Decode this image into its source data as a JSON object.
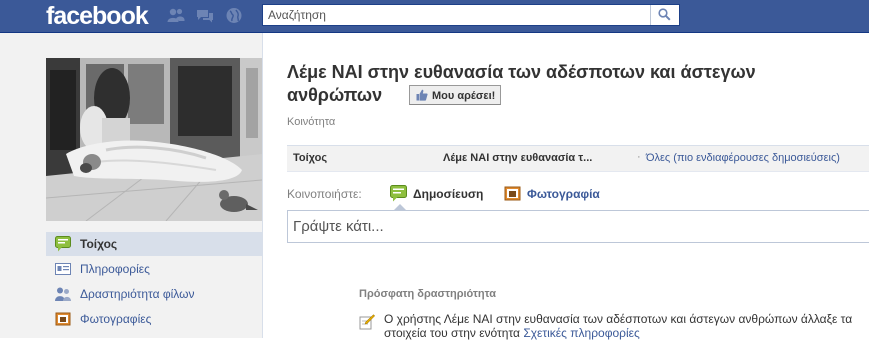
{
  "header": {
    "logo_text": "facebook",
    "search_placeholder": "Αναζήτηση",
    "brand_color": "#3b5998"
  },
  "sidebar": {
    "nav_items": [
      {
        "label": "Τοίχος",
        "icon": "wall-icon",
        "active": true
      },
      {
        "label": "Πληροφορίες",
        "icon": "info-icon",
        "active": false
      },
      {
        "label": "Δραστηριότητα φίλων",
        "icon": "friends-icon",
        "active": false
      },
      {
        "label": "Φωτογραφίες",
        "icon": "photos-icon",
        "active": false
      }
    ]
  },
  "page": {
    "title_line1": "Λέμε ΝΑΙ στην ευθανασία των αδέσποτων και άστεγων",
    "title_line2": "ανθρώπων",
    "like_button": "Μου αρέσει!",
    "category": "Κοινότητα"
  },
  "tabs": {
    "wall": "Τοίχος",
    "page_posts": "Λέμε ΝΑΙ στην ευθανασία τ...",
    "separator": "·",
    "filter": "Όλες (πιο ενδιαφέρουσες δημοσιεύσεις)"
  },
  "composer": {
    "share_label": "Κοινοποιήστε:",
    "post_option": "Δημοσίευση",
    "photo_option": "Φωτογραφία",
    "placeholder": "Γράψτε κάτι..."
  },
  "recent": {
    "header": "Πρόσφατη δραστηριότητα",
    "item_text": "Ο χρήστης Λέμε ΝΑΙ στην ευθανασία των αδέσποτων και άστεγων ανθρώπων άλλαξε τα στοιχεία του στην ενότητα ",
    "item_link": "Σχετικές πληροφορίες"
  }
}
